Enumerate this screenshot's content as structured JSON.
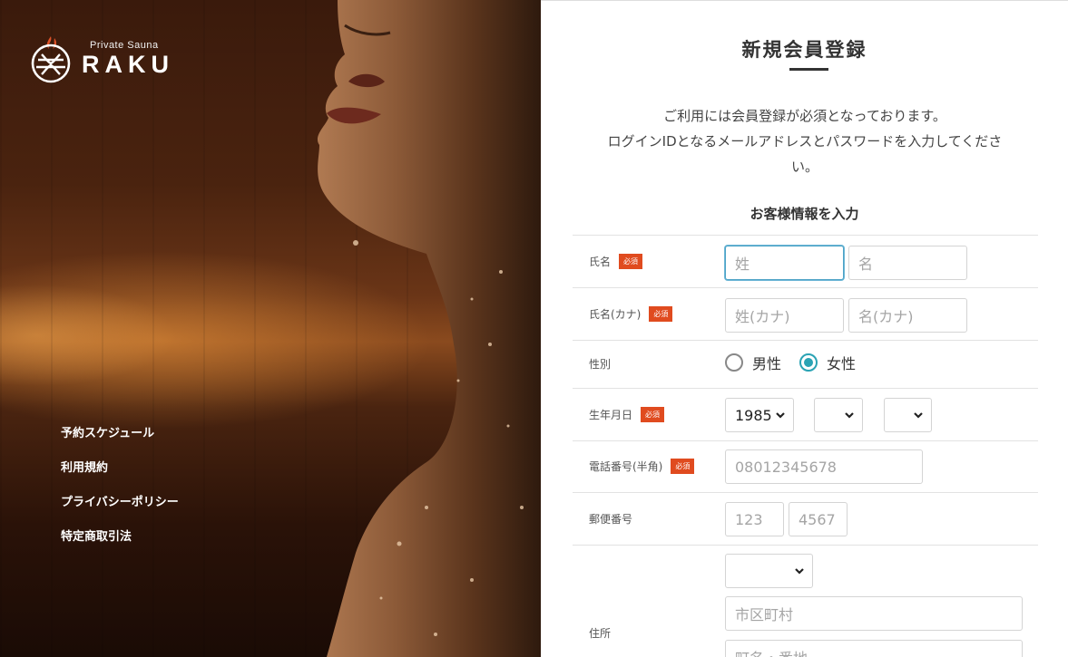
{
  "brand": {
    "sub": "Private Sauna",
    "name": "RAKU"
  },
  "nav": [
    {
      "label": "予約スケジュール"
    },
    {
      "label": "利用規約"
    },
    {
      "label": "プライバシーポリシー"
    },
    {
      "label": "特定商取引法"
    }
  ],
  "form": {
    "title": "新規会員登録",
    "intro_line1": "ご利用には会員登録が必須となっております。",
    "intro_line2": "ログインIDとなるメールアドレスとパスワードを入力してくださ",
    "intro_line3": "い。",
    "section": "お客様情報を入力",
    "required_badge": "必須",
    "name": {
      "label": "氏名",
      "last_placeholder": "姓",
      "first_placeholder": "名"
    },
    "kana": {
      "label": "氏名(カナ)",
      "last_placeholder": "姓(カナ)",
      "first_placeholder": "名(カナ)"
    },
    "gender": {
      "label": "性別",
      "options": [
        "男性",
        "女性"
      ],
      "selected": "女性"
    },
    "birth": {
      "label": "生年月日",
      "year": "1985",
      "month": "",
      "day": ""
    },
    "phone": {
      "label": "電話番号(半角)",
      "placeholder": "08012345678"
    },
    "postal": {
      "label": "郵便番号",
      "placeholder1": "123",
      "placeholder2": "4567"
    },
    "address": {
      "label": "住所",
      "prefecture": "",
      "city_placeholder": "市区町村",
      "street_placeholder": "町名・番地"
    }
  },
  "colors": {
    "required": "#e04b1f",
    "radio_selected": "#2aa3b4",
    "focus": "#4da3c6"
  }
}
